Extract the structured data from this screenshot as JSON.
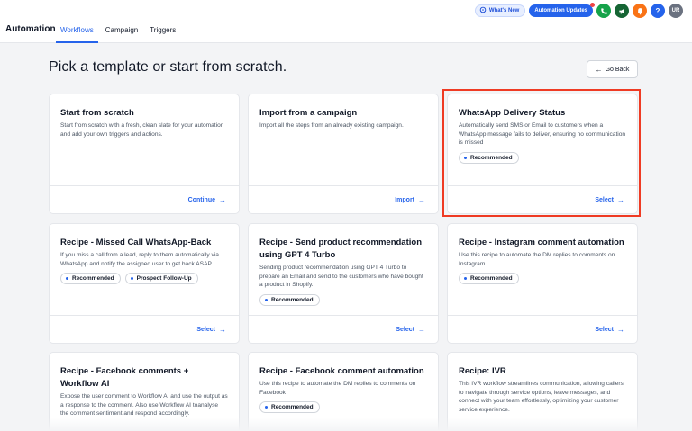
{
  "header": {
    "app_title": "Automation",
    "tabs": [
      {
        "label": "Workflows",
        "active": true
      },
      {
        "label": "Campaign",
        "active": false
      },
      {
        "label": "Triggers",
        "active": false
      }
    ],
    "whats_new": "What's New",
    "updates": "Automation Updates",
    "help": "?",
    "avatar": "UR"
  },
  "main": {
    "title": "Pick a template or start from scratch.",
    "back_label": "Go Back"
  },
  "cards": [
    {
      "title": "Start from scratch",
      "desc": "Start from scratch with a fresh, clean slate for your automation and add your own triggers and actions.",
      "action": "Continue",
      "badges": []
    },
    {
      "title": "Import from a campaign",
      "desc": "Import all the steps from an already existing campaign.",
      "action": "Import",
      "badges": []
    },
    {
      "title": "WhatsApp Delivery Status",
      "desc": "Automatically send SMS or Email to customers when a WhatsApp message fails to deliver, ensuring no communication is missed",
      "action": "Select",
      "badges": [
        "Recommended"
      ]
    },
    {
      "title": "Recipe - Missed Call WhatsApp-Back",
      "desc": "If you miss a call from a lead, reply to them automatically via WhatsApp and notify the assigned user to get back ASAP",
      "action": "Select",
      "badges": [
        "Recommended",
        "Prospect Follow-Up"
      ]
    },
    {
      "title": "Recipe - Send product recommendation using GPT 4 Turbo",
      "desc": "Sending product recommendation using GPT 4 Turbo to prepare an Email and send to the customers who have bought a product in Shopify.",
      "action": "Select",
      "badges": [
        "Recommended"
      ]
    },
    {
      "title": "Recipe - Instagram comment automation",
      "desc": "Use this recipe to automate the DM replies to comments on Instagram",
      "action": "Select",
      "badges": [
        "Recommended"
      ]
    },
    {
      "title": "Recipe - Facebook comments + Workflow AI",
      "desc": "Expose the user comment to Workflow AI and use the output as a response to the comment. Also use Workflow AI toanalyse the comment sentiment and respond accordingly.",
      "action": "",
      "badges": []
    },
    {
      "title": "Recipe - Facebook comment automation",
      "desc": "Use this recipe to automate the DM replies to comments on Facebook",
      "action": "",
      "badges": [
        "Recommended"
      ]
    },
    {
      "title": "Recipe: IVR",
      "desc": "This IVR workflow streamlines communication, allowing callers to navigate through service options, leave messages, and connect with your team effortlessly, optimizing your customer service experience.",
      "action": "",
      "badges": []
    }
  ],
  "colors": {
    "accent": "#2563eb",
    "highlight": "#ef3b24"
  }
}
